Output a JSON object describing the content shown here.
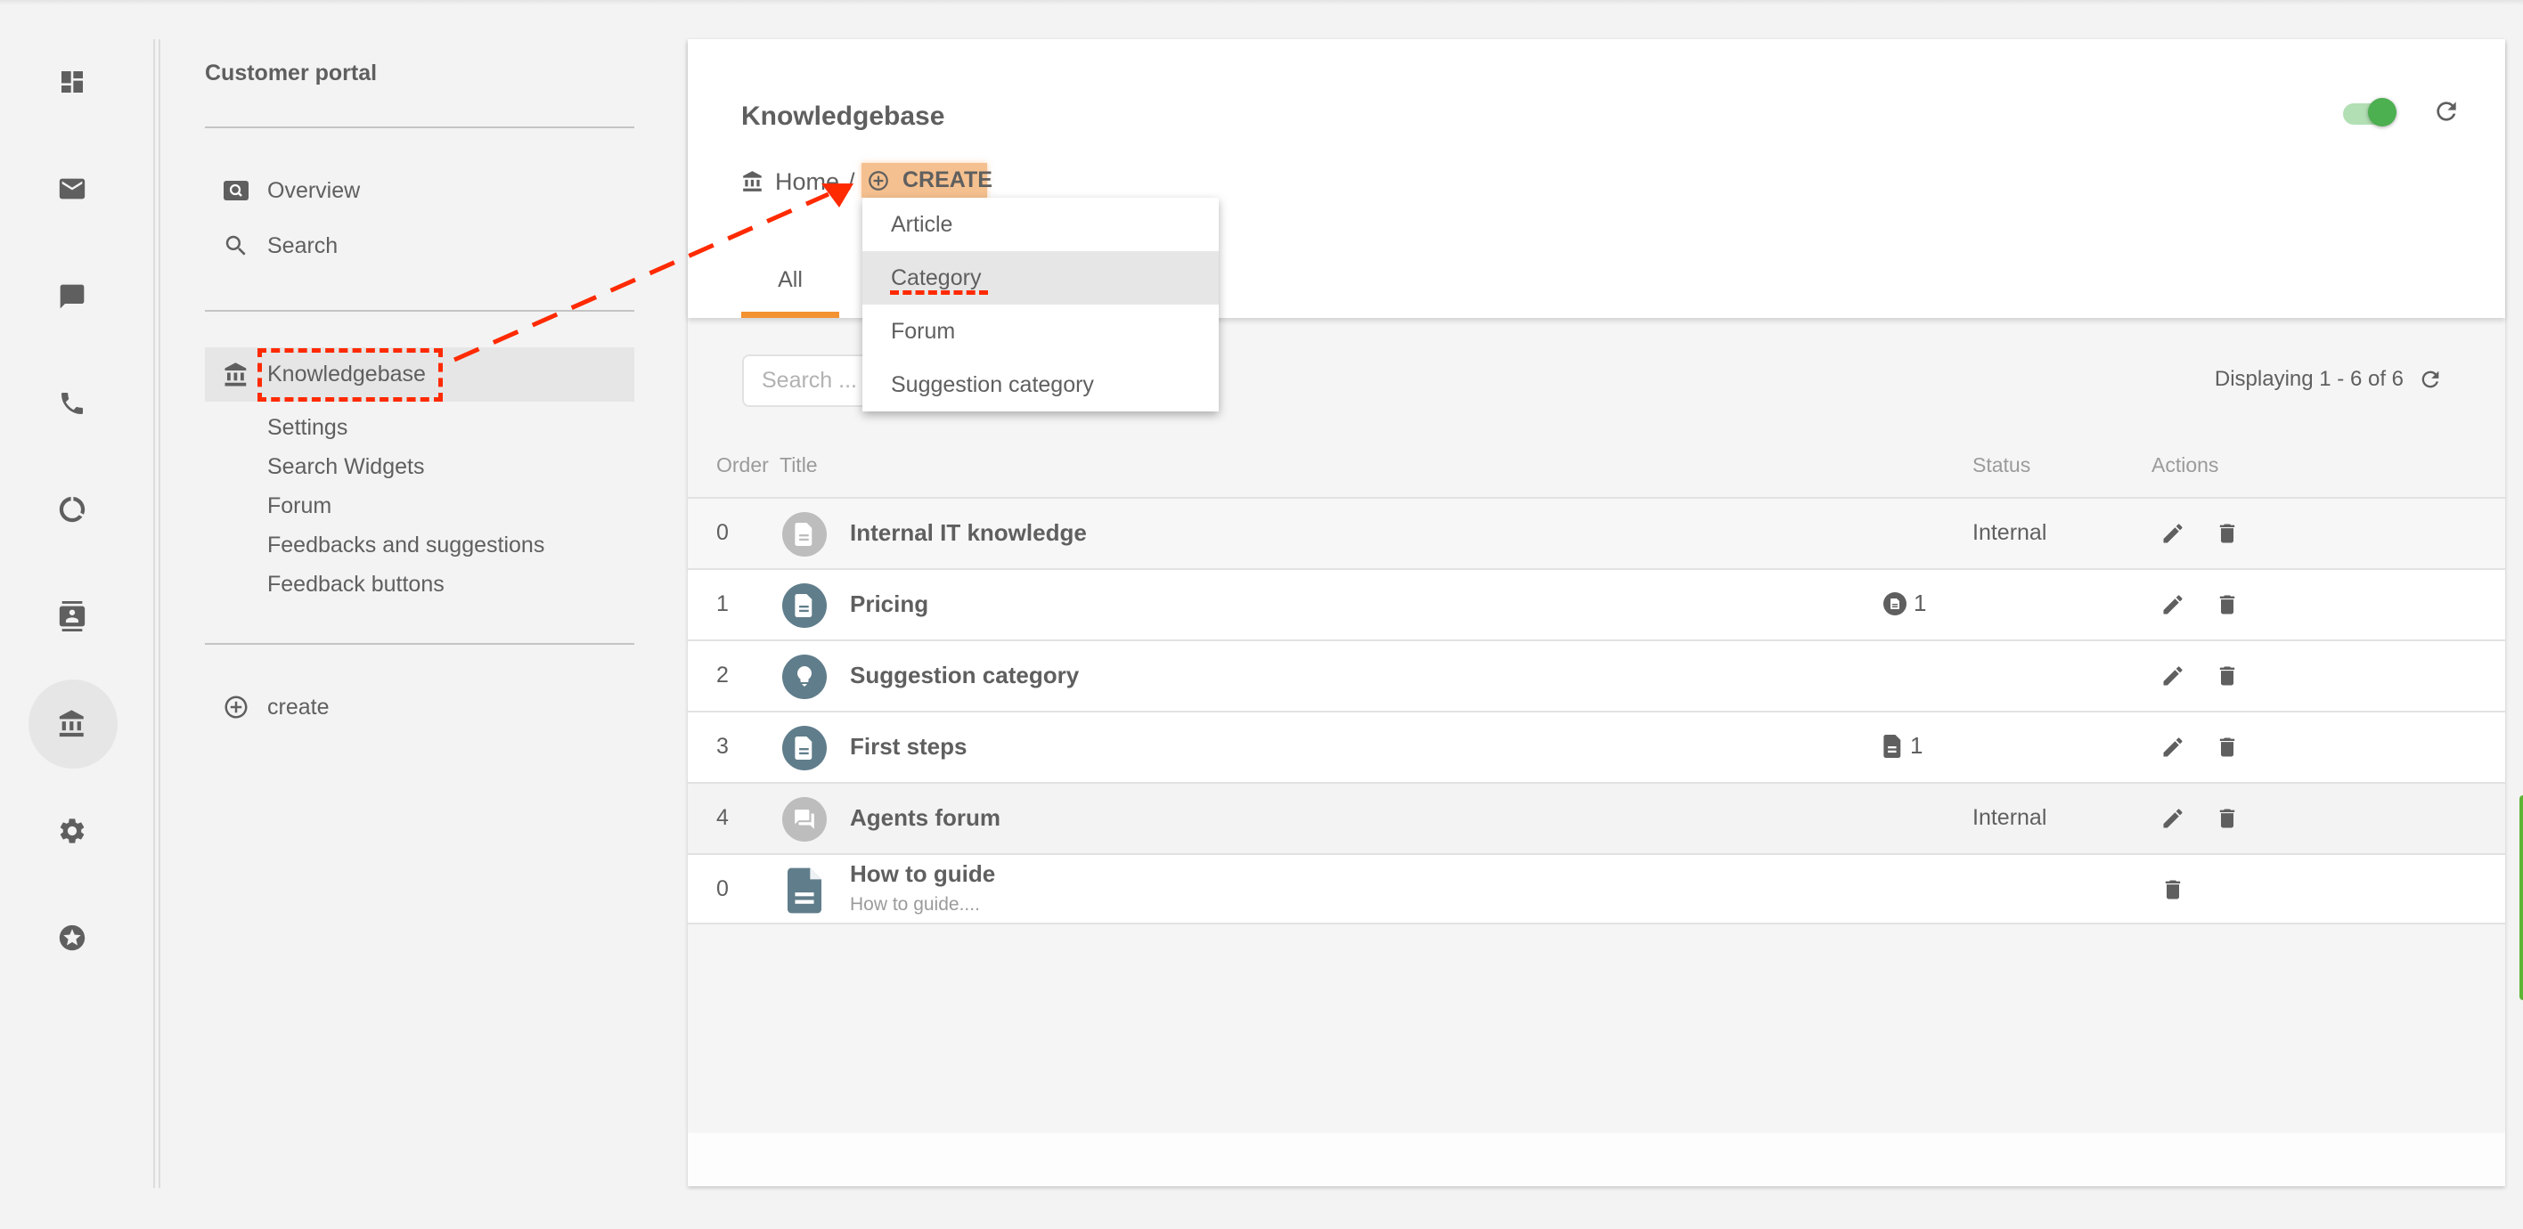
{
  "rail": {
    "items": [
      {
        "name": "dashboard",
        "icon": "dashboard-icon"
      },
      {
        "name": "email",
        "icon": "envelope-icon"
      },
      {
        "name": "chat",
        "icon": "chat-bubble-icon"
      },
      {
        "name": "phone",
        "icon": "phone-icon"
      },
      {
        "name": "reports",
        "icon": "donut-chart-icon"
      },
      {
        "name": "contacts",
        "icon": "contact-card-icon"
      },
      {
        "name": "knowledgebase",
        "icon": "bank-icon",
        "active": true
      },
      {
        "name": "settings",
        "icon": "gear-icon"
      },
      {
        "name": "favorites",
        "icon": "star-circle-icon"
      }
    ]
  },
  "sidebar": {
    "title": "Customer portal",
    "items": [
      {
        "label": "Overview",
        "icon": "overview-search-icon"
      },
      {
        "label": "Search",
        "icon": "search-icon"
      }
    ],
    "knowledgebase": {
      "label": "Knowledgebase",
      "icon": "bank-icon",
      "active": true
    },
    "subitems": [
      "Settings",
      "Search Widgets",
      "Forum",
      "Feedbacks and suggestions",
      "Feedback buttons"
    ],
    "create": {
      "label": "create",
      "icon": "plus-circle-icon"
    }
  },
  "header": {
    "title": "Knowledgebase",
    "breadcrumb": {
      "home": "Home",
      "separator": "/",
      "create": "CREATE"
    },
    "toggle_on": true,
    "tabs": [
      {
        "label": "All",
        "active": true
      }
    ]
  },
  "dropdown": {
    "items": [
      "Article",
      "Category",
      "Forum",
      "Suggestion category"
    ],
    "hovered": "Category"
  },
  "toolbar": {
    "search_placeholder": "Search ...",
    "displaying": "Displaying 1 - 6 of 6"
  },
  "table": {
    "columns": {
      "order": "Order",
      "title": "Title",
      "status": "Status",
      "actions": "Actions"
    },
    "rows": [
      {
        "order": "0",
        "title": "Internal IT knowledge",
        "type": "category",
        "icon_color": "#bdbdbd",
        "count": "",
        "status": "Internal",
        "edit": true,
        "delete": true
      },
      {
        "order": "1",
        "title": "Pricing",
        "type": "category",
        "icon_color": "#607d8b",
        "count": "1",
        "count_icon": "category-badge-icon",
        "status": "",
        "edit": true,
        "delete": true
      },
      {
        "order": "2",
        "title": "Suggestion category",
        "type": "suggestion",
        "icon_color": "#607d8b",
        "count": "",
        "status": "",
        "edit": true,
        "delete": true
      },
      {
        "order": "3",
        "title": "First steps",
        "type": "category",
        "icon_color": "#607d8b",
        "count": "1",
        "count_icon": "article-file-icon",
        "status": "",
        "edit": true,
        "delete": true
      },
      {
        "order": "4",
        "title": "Agents forum",
        "type": "forum",
        "icon_color": "#bdbdbd",
        "count": "",
        "status": "Internal",
        "edit": true,
        "delete": true
      },
      {
        "order": "0",
        "title": "How to guide",
        "subtitle": "How to guide....",
        "type": "article",
        "icon_color": "#607d8b",
        "count": "",
        "status": "",
        "edit": false,
        "delete": true
      }
    ]
  },
  "colors": {
    "accent": "#f39231",
    "create_highlight": "#f5c08f",
    "toggle": "#4caf50",
    "annotation": "#ff2a00",
    "icon_dark": "#5f5f5f"
  }
}
